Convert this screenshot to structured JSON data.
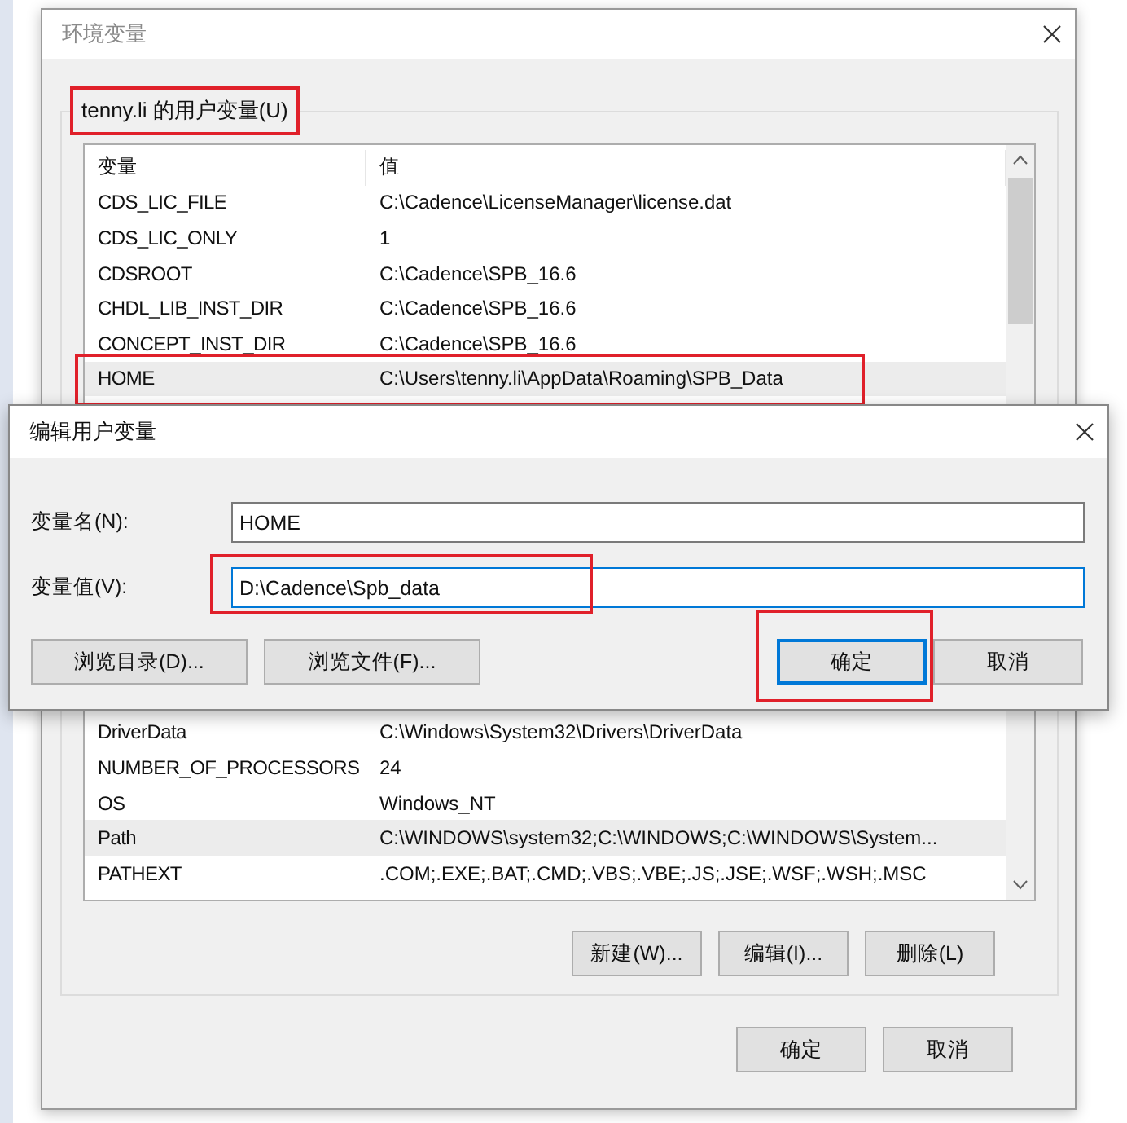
{
  "env_window": {
    "title": "环境变量",
    "user_vars": {
      "label": "tenny.li 的用户变量(U)",
      "highlighted": true,
      "columns": [
        "变量",
        "值"
      ],
      "rows_top": [
        {
          "name": "CDS_LIC_FILE",
          "value": "C:\\Cadence\\LicenseManager\\license.dat",
          "selected": false,
          "highlighted": false
        },
        {
          "name": "CDS_LIC_ONLY",
          "value": "1",
          "selected": false,
          "highlighted": false
        },
        {
          "name": "CDSROOT",
          "value": "C:\\Cadence\\SPB_16.6",
          "selected": false,
          "highlighted": false
        },
        {
          "name": "CHDL_LIB_INST_DIR",
          "value": "C:\\Cadence\\SPB_16.6",
          "selected": false,
          "highlighted": false
        },
        {
          "name": "CONCEPT_INST_DIR",
          "value": "C:\\Cadence\\SPB_16.6",
          "selected": false,
          "highlighted": false
        },
        {
          "name": "HOME",
          "value": "C:\\Users\\tenny.li\\AppData\\Roaming\\SPB_Data",
          "selected": true,
          "highlighted": true
        }
      ],
      "rows_bottom": [
        {
          "name": "DriverData",
          "value": "C:\\Windows\\System32\\Drivers\\DriverData",
          "selected": false,
          "highlighted": false
        },
        {
          "name": "NUMBER_OF_PROCESSORS",
          "value": "24",
          "selected": false,
          "highlighted": false
        },
        {
          "name": "OS",
          "value": "Windows_NT",
          "selected": false,
          "highlighted": false
        },
        {
          "name": "Path",
          "value": "C:\\WINDOWS\\system32;C:\\WINDOWS;C:\\WINDOWS\\System...",
          "selected": true,
          "highlighted": false
        },
        {
          "name": "PATHEXT",
          "value": ".COM;.EXE;.BAT;.CMD;.VBS;.VBE;.JS;.JSE;.WSF;.WSH;.MSC",
          "selected": false,
          "highlighted": false
        }
      ],
      "buttons": [
        "新建(W)...",
        "编辑(I)...",
        "删除(L)"
      ]
    },
    "buttons": [
      "确定",
      "取消"
    ]
  },
  "edit_dialog": {
    "title": "编辑用户变量",
    "fields": [
      {
        "label": "变量名(N):",
        "value": "HOME",
        "focused": false,
        "highlighted": false
      },
      {
        "label": "变量值(V):",
        "value": "D:\\Cadence\\Spb_data",
        "focused": true,
        "highlighted": true
      }
    ],
    "browse_buttons": [
      "浏览目录(D)...",
      "浏览文件(F)..."
    ],
    "buttons": [
      {
        "label": "确定",
        "default": true,
        "highlighted": true
      },
      {
        "label": "取消",
        "default": false,
        "highlighted": false
      }
    ]
  }
}
